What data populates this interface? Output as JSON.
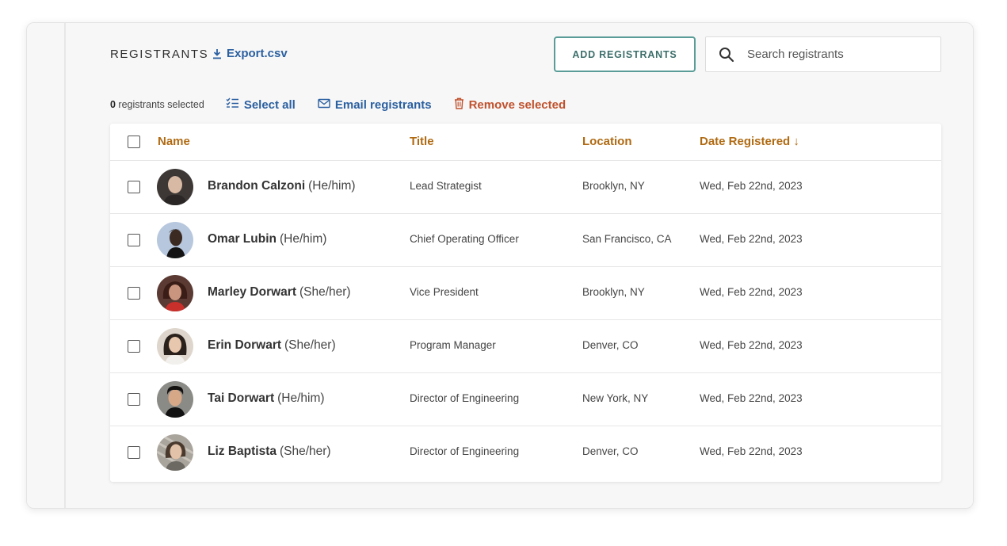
{
  "header": {
    "title": "REGISTRANTS",
    "export_label": "Export.csv",
    "add_button_label": "ADD REGISTRANTS",
    "search_placeholder": "Search registrants"
  },
  "toolbar": {
    "selected_count": "0",
    "selected_suffix": " registrants selected",
    "select_all_label": "Select all",
    "email_label": "Email registrants",
    "remove_label": "Remove selected"
  },
  "table": {
    "columns": {
      "name": "Name",
      "title": "Title",
      "location": "Location",
      "date_registered": "Date Registered ↓"
    },
    "rows": [
      {
        "name": "Brandon Calzoni",
        "pronouns": "(He/him)",
        "title": "Lead Strategist",
        "location": "Brooklyn, NY",
        "date": "Wed, Feb 22nd, 2023"
      },
      {
        "name": "Omar Lubin",
        "pronouns": "(He/him)",
        "title": "Chief Operating Officer",
        "location": "San Francisco, CA",
        "date": "Wed, Feb 22nd, 2023"
      },
      {
        "name": "Marley Dorwart",
        "pronouns": "(She/her)",
        "title": "Vice President",
        "location": "Brooklyn, NY",
        "date": "Wed, Feb 22nd, 2023"
      },
      {
        "name": "Erin Dorwart",
        "pronouns": "(She/her)",
        "title": "Program Manager",
        "location": "Denver, CO",
        "date": "Wed, Feb 22nd, 2023"
      },
      {
        "name": "Tai Dorwart",
        "pronouns": "(He/him)",
        "title": "Director of Engineering",
        "location": "New York, NY",
        "date": "Wed, Feb 22nd, 2023"
      },
      {
        "name": "Liz Baptista",
        "pronouns": "(She/her)",
        "title": "Director of Engineering",
        "location": "Denver, CO",
        "date": "Wed, Feb 22nd, 2023"
      }
    ]
  },
  "colors": {
    "link_blue": "#2a5fa0",
    "header_orange": "#b06a12",
    "danger_red": "#c0512c",
    "button_teal": "#5a9c97"
  },
  "icons": {
    "export": "download-icon",
    "search": "search-icon",
    "select_all": "checklist-icon",
    "email": "envelope-icon",
    "remove": "trash-icon"
  }
}
